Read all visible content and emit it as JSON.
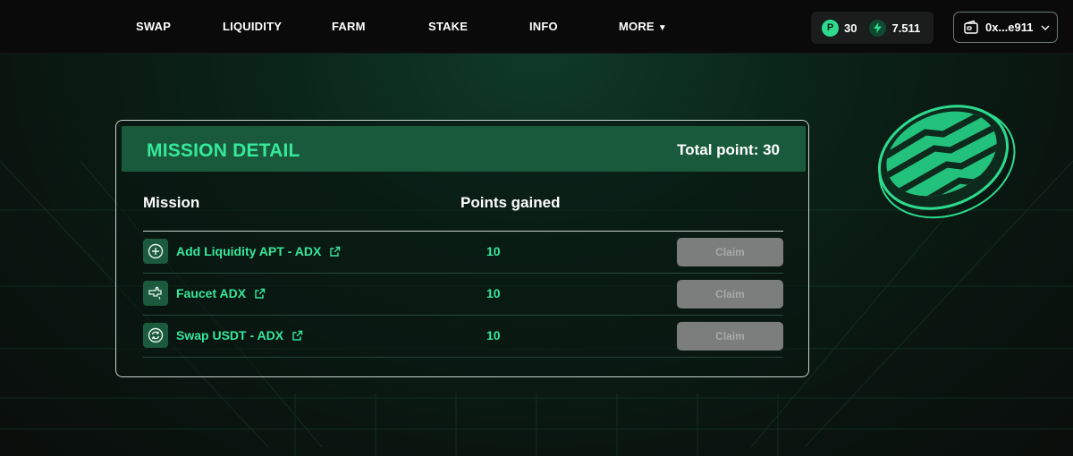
{
  "nav": {
    "items": [
      {
        "label": "SWAP"
      },
      {
        "label": "LIQUIDITY"
      },
      {
        "label": "FARM"
      },
      {
        "label": "STAKE"
      },
      {
        "label": "INFO"
      },
      {
        "label": "MORE"
      }
    ],
    "more_caret": "▼",
    "points": {
      "icon_letter": "P",
      "value": "30"
    },
    "energy": {
      "value": "7.511"
    },
    "wallet": {
      "address": "0x...e911"
    }
  },
  "panel": {
    "title": "MISSION DETAIL",
    "total_point": "Total point: 30",
    "columns": {
      "mission": "Mission",
      "points": "Points gained"
    },
    "rows": [
      {
        "name": "Add Liquidity APT - ADX",
        "points": "10",
        "claim": "Claim",
        "icon": "plus-circle-icon"
      },
      {
        "name": "Faucet ADX",
        "points": "10",
        "claim": "Claim",
        "icon": "faucet-icon"
      },
      {
        "name": "Swap USDT - ADX",
        "points": "10",
        "claim": "Claim",
        "icon": "swap-cycle-icon"
      }
    ]
  },
  "colors": {
    "accent": "#36e89b",
    "header_bg": "#1a5a3c",
    "claim_disabled": "#7c7d7d",
    "page_bg": "#0b0f0d"
  }
}
